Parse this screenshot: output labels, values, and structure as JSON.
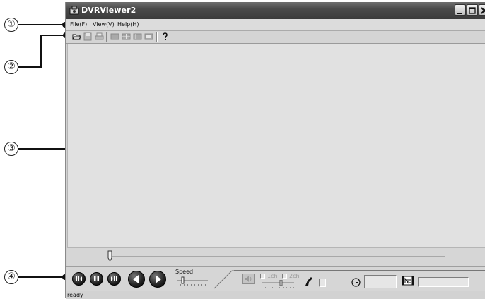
{
  "window": {
    "title": "DVRViewer2"
  },
  "menu": {
    "items": [
      "File(F)",
      "View(V)",
      "Help(H)"
    ]
  },
  "toolbar": {
    "icons": [
      "open-folder-icon",
      "save-icon",
      "print-icon",
      "single-view-icon",
      "quad-view-icon",
      "layout-a-icon",
      "layout-b-icon",
      "help-icon"
    ]
  },
  "callouts": [
    "①",
    "②",
    "③",
    "④"
  ],
  "controls": {
    "speed_label": "Speed",
    "ch1_label": "1ch",
    "ch2_label": "2ch"
  },
  "status": {
    "text": "ready"
  }
}
